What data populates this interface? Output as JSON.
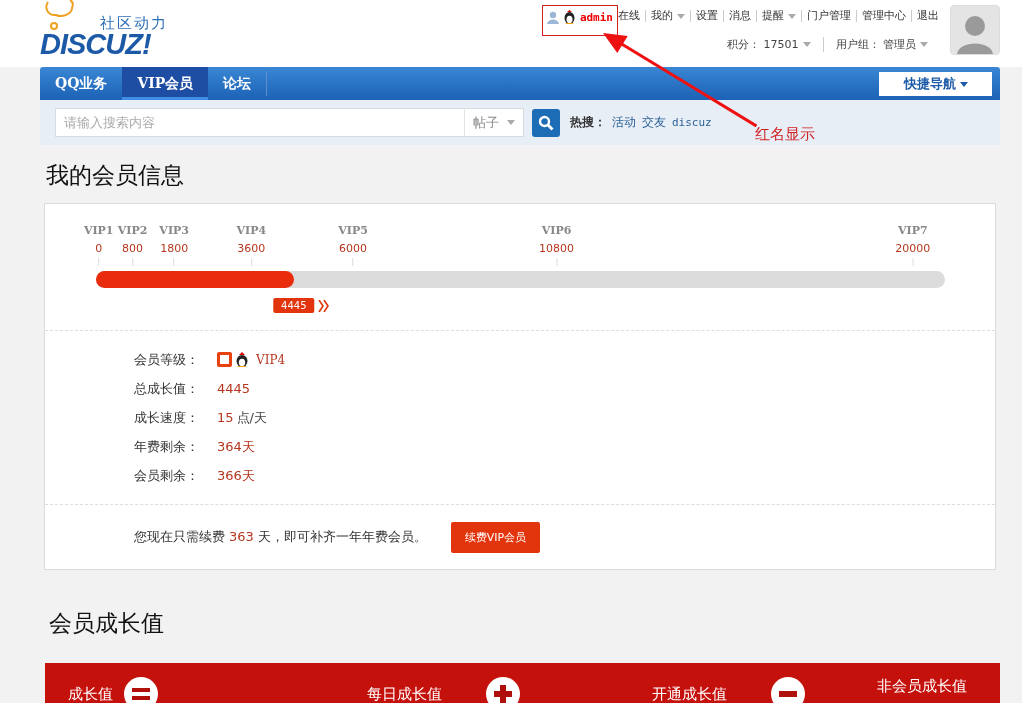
{
  "logo": {
    "tagline": "社区动力",
    "brand": "DISCUZ!"
  },
  "user_bar": {
    "name": "admin",
    "links": [
      {
        "label": "在线",
        "dropdown": false
      },
      {
        "label": "我的",
        "dropdown": true
      },
      {
        "label": "设置",
        "dropdown": false
      },
      {
        "label": "消息",
        "dropdown": false
      },
      {
        "label": "提醒",
        "dropdown": true
      },
      {
        "label": "门户管理",
        "dropdown": false
      },
      {
        "label": "管理中心",
        "dropdown": false
      },
      {
        "label": "退出",
        "dropdown": false
      }
    ],
    "stats": [
      {
        "label": "积分：",
        "value": "17501"
      },
      {
        "label": "用户组：",
        "value": "管理员"
      }
    ]
  },
  "annotation": {
    "text": "红名显示"
  },
  "nav": {
    "tabs": [
      {
        "label": "QQ业务",
        "selected": false
      },
      {
        "label": "VIP会员",
        "selected": true
      },
      {
        "label": "论坛",
        "selected": false
      }
    ],
    "quick_nav": "快捷导航"
  },
  "search": {
    "placeholder": "请输入搜索内容",
    "type": "帖子",
    "hot_label": "热搜：",
    "hot_links": [
      "活动",
      "交友",
      "discuz"
    ]
  },
  "vip_title": "我的会员信息",
  "levels": [
    {
      "name": "VIP1",
      "value": "0"
    },
    {
      "name": "VIP2",
      "value": "800"
    },
    {
      "name": "VIP3",
      "value": "1800"
    },
    {
      "name": "VIP4",
      "value": "3600"
    },
    {
      "name": "VIP5",
      "value": "6000"
    },
    {
      "name": "VIP6",
      "value": "10800"
    },
    {
      "name": "VIP7",
      "value": "20000"
    }
  ],
  "progress": {
    "level": 0.233,
    "reading": "4445"
  },
  "info": [
    {
      "kind": "level",
      "label": "会员等级：",
      "value": "VIP4"
    },
    {
      "kind": "plain",
      "label": "总成长值：",
      "value": "4445"
    },
    {
      "kind": "unit",
      "label": "成长速度：",
      "value": "15",
      "unit": "点/天"
    },
    {
      "kind": "plain",
      "label": "年费剩余：",
      "value": "364天"
    },
    {
      "kind": "plain",
      "label": "会员剩余：",
      "value": "366天"
    }
  ],
  "renewal": {
    "before": "您现在只需续费",
    "days": "363",
    "after": "天，即可补齐一年年费会员。",
    "button": "续费VIP会员"
  },
  "growth_title": "会员成长值",
  "growth_bar": [
    {
      "label": "成长值",
      "kind": "equals"
    },
    {
      "label": "每日成长值",
      "kind": "plus"
    },
    {
      "label": "开通成长值",
      "kind": "minus"
    },
    {
      "label": "非会员成长值",
      "kind": "none"
    }
  ]
}
